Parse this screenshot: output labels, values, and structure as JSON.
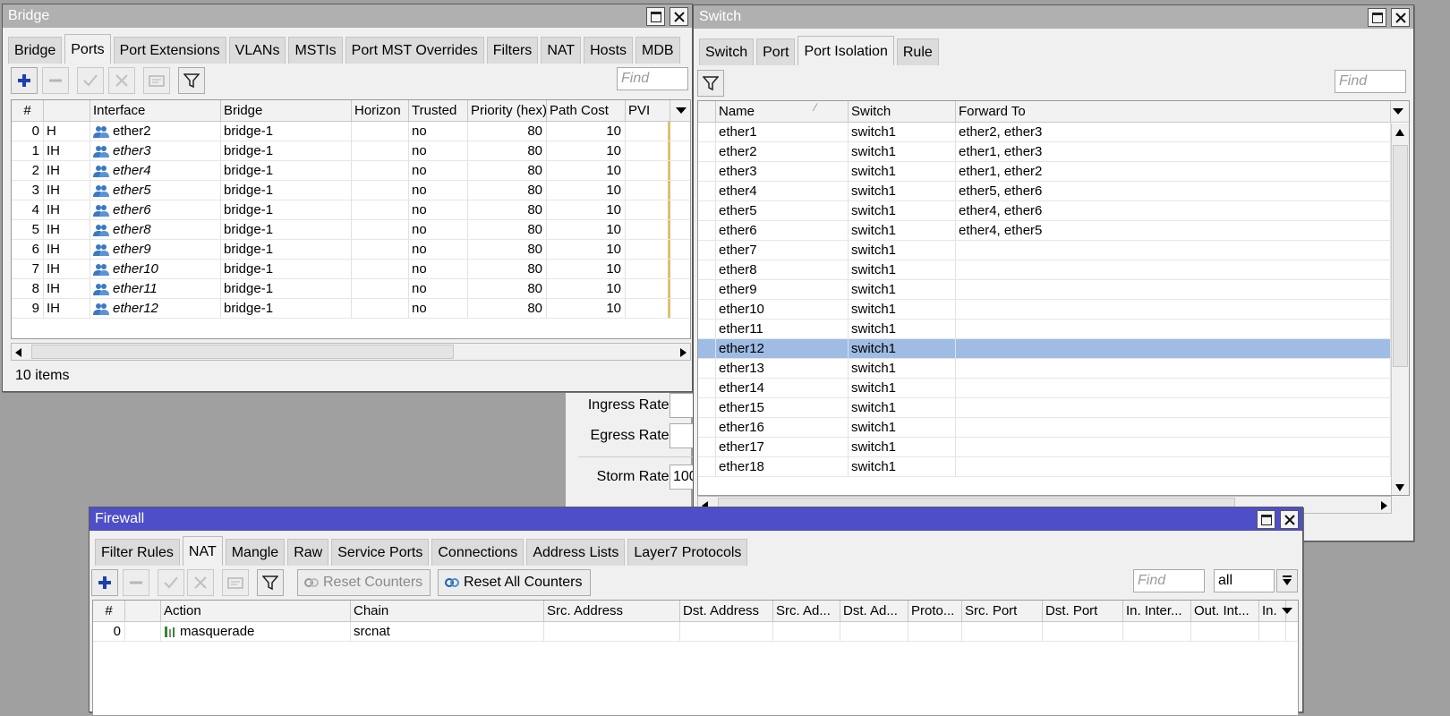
{
  "bridge": {
    "title": "Bridge",
    "tabs": [
      "Bridge",
      "Ports",
      "Port Extensions",
      "VLANs",
      "MSTIs",
      "Port MST Overrides",
      "Filters",
      "NAT",
      "Hosts",
      "MDB"
    ],
    "find_placeholder": "Find",
    "columns": [
      "#",
      "",
      "Interface",
      "Bridge",
      "Horizon",
      "Trusted",
      "Priority (hex)",
      "Path Cost",
      "PVI"
    ],
    "rows": [
      {
        "num": "0",
        "flags": "H",
        "iface": "ether2",
        "bridge": "bridge-1",
        "horizon": "",
        "trusted": "no",
        "priority": "80",
        "cost": "10"
      },
      {
        "num": "1",
        "flags": "IH",
        "iface": "ether3",
        "bridge": "bridge-1",
        "horizon": "",
        "trusted": "no",
        "priority": "80",
        "cost": "10"
      },
      {
        "num": "2",
        "flags": "IH",
        "iface": "ether4",
        "bridge": "bridge-1",
        "horizon": "",
        "trusted": "no",
        "priority": "80",
        "cost": "10"
      },
      {
        "num": "3",
        "flags": "IH",
        "iface": "ether5",
        "bridge": "bridge-1",
        "horizon": "",
        "trusted": "no",
        "priority": "80",
        "cost": "10"
      },
      {
        "num": "4",
        "flags": "IH",
        "iface": "ether6",
        "bridge": "bridge-1",
        "horizon": "",
        "trusted": "no",
        "priority": "80",
        "cost": "10"
      },
      {
        "num": "5",
        "flags": "IH",
        "iface": "ether8",
        "bridge": "bridge-1",
        "horizon": "",
        "trusted": "no",
        "priority": "80",
        "cost": "10"
      },
      {
        "num": "6",
        "flags": "IH",
        "iface": "ether9",
        "bridge": "bridge-1",
        "horizon": "",
        "trusted": "no",
        "priority": "80",
        "cost": "10"
      },
      {
        "num": "7",
        "flags": "IH",
        "iface": "ether10",
        "bridge": "bridge-1",
        "horizon": "",
        "trusted": "no",
        "priority": "80",
        "cost": "10"
      },
      {
        "num": "8",
        "flags": "IH",
        "iface": "ether11",
        "bridge": "bridge-1",
        "horizon": "",
        "trusted": "no",
        "priority": "80",
        "cost": "10"
      },
      {
        "num": "9",
        "flags": "IH",
        "iface": "ether12",
        "bridge": "bridge-1",
        "horizon": "",
        "trusted": "no",
        "priority": "80",
        "cost": "10"
      }
    ],
    "status": "10 items"
  },
  "switch": {
    "title": "Switch",
    "tabs": [
      "Switch",
      "Port",
      "Port Isolation",
      "Rule"
    ],
    "find_placeholder": "Find",
    "columns": [
      "Name",
      "Switch",
      "Forward To"
    ],
    "rows": [
      {
        "name": "ether1",
        "switch": "switch1",
        "forward": "ether2, ether3"
      },
      {
        "name": "ether2",
        "switch": "switch1",
        "forward": "ether1, ether3"
      },
      {
        "name": "ether3",
        "switch": "switch1",
        "forward": "ether1, ether2"
      },
      {
        "name": "ether4",
        "switch": "switch1",
        "forward": "ether5, ether6"
      },
      {
        "name": "ether5",
        "switch": "switch1",
        "forward": "ether4, ether6"
      },
      {
        "name": "ether6",
        "switch": "switch1",
        "forward": "ether4, ether5"
      },
      {
        "name": "ether7",
        "switch": "switch1",
        "forward": ""
      },
      {
        "name": "ether8",
        "switch": "switch1",
        "forward": ""
      },
      {
        "name": "ether9",
        "switch": "switch1",
        "forward": ""
      },
      {
        "name": "ether10",
        "switch": "switch1",
        "forward": ""
      },
      {
        "name": "ether11",
        "switch": "switch1",
        "forward": ""
      },
      {
        "name": "ether12",
        "switch": "switch1",
        "forward": ""
      },
      {
        "name": "ether13",
        "switch": "switch1",
        "forward": ""
      },
      {
        "name": "ether14",
        "switch": "switch1",
        "forward": ""
      },
      {
        "name": "ether15",
        "switch": "switch1",
        "forward": ""
      },
      {
        "name": "ether16",
        "switch": "switch1",
        "forward": ""
      },
      {
        "name": "ether17",
        "switch": "switch1",
        "forward": ""
      },
      {
        "name": "ether18",
        "switch": "switch1",
        "forward": ""
      }
    ],
    "selected_row": "ether12"
  },
  "port_dialog": {
    "ingress_label": "Ingress Rate:",
    "egress_label": "Egress Rate:",
    "storm_label": "Storm Rate:",
    "storm_value": "100"
  },
  "firewall": {
    "title": "Firewall",
    "tabs": [
      "Filter Rules",
      "NAT",
      "Mangle",
      "Raw",
      "Service Ports",
      "Connections",
      "Address Lists",
      "Layer7 Protocols"
    ],
    "reset_counters": "Reset Counters",
    "reset_all_counters": "Reset All Counters",
    "find_placeholder": "Find",
    "filter_value": "all",
    "columns": [
      "#",
      "",
      "Action",
      "Chain",
      "Src. Address",
      "Dst. Address",
      "Src. Ad...",
      "Dst. Ad...",
      "Proto...",
      "Src. Port",
      "Dst. Port",
      "In. Inter...",
      "Out. Int...",
      "In."
    ],
    "rows": [
      {
        "num": "0",
        "flag": "",
        "action": "masquerade",
        "chain": "srcnat"
      }
    ]
  },
  "colors": {
    "active_title": "#4e4ec8",
    "inactive_title": "#b0b0b0",
    "selected_row": "#9ebce4",
    "add_icon": "#1e3fae"
  }
}
